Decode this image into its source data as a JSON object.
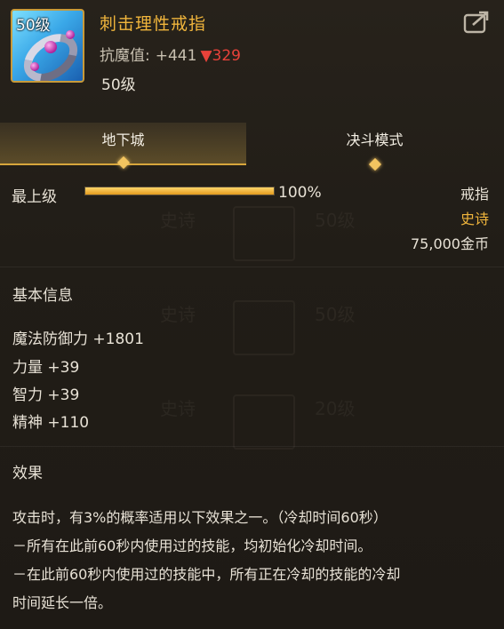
{
  "item": {
    "icon_level": "50级",
    "name": "刺击理性戒指",
    "resist_label": "抗魔值:",
    "resist_plus": "+441",
    "resist_down": "▼329",
    "level_text": "50级"
  },
  "tabs": [
    {
      "label": "地下城",
      "active": true
    },
    {
      "label": "决斗模式",
      "active": false
    }
  ],
  "grade": {
    "label": "最上级",
    "percent_text": "100%",
    "fill_fraction": 1.0
  },
  "info": {
    "type": "戒指",
    "rarity": "史诗",
    "price": "75,000金币"
  },
  "basic": {
    "title": "基本信息",
    "stats": [
      "魔法防御力 +1801",
      "力量 +39",
      "智力 +39",
      "精神 +110"
    ]
  },
  "effect": {
    "title": "效果",
    "lines": [
      "攻击时，有3%的概率适用以下效果之一。（冷却时间60秒）",
      "－所有在此前60秒内使用过的技能，均初始化冷却时间。",
      "－在此前60秒内使用过的技能中，所有正在冷却的技能的冷却",
      "时间延长一倍。"
    ]
  },
  "icons": {
    "share": "share-icon",
    "tab_marker": "diamond-icon"
  },
  "colors": {
    "accent": "#f0b53c",
    "decrease": "#e8423a",
    "bar": "#f2b13a"
  }
}
